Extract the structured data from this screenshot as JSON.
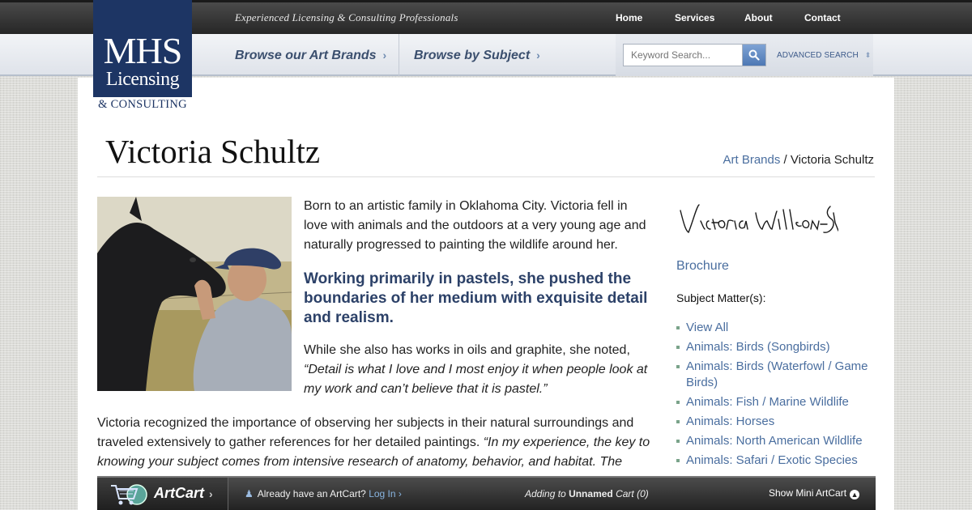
{
  "header": {
    "tagline": "Experienced Licensing & Consulting Professionals",
    "nav": [
      {
        "label": "Home"
      },
      {
        "label": "Services"
      },
      {
        "label": "About"
      },
      {
        "label": "Contact"
      }
    ]
  },
  "logo": {
    "line1": "MHS",
    "line2": "Licensing",
    "line3": "& CONSULTING"
  },
  "subnav": {
    "items": [
      {
        "label": "Browse our Art Brands",
        "icon": "chevron-right-icon"
      },
      {
        "label": "Browse by Subject",
        "icon": "chevron-right-icon"
      }
    ],
    "search_placeholder": "Keyword Search...",
    "search_icon": "search-icon",
    "advanced_search": "ADVANCED SEARCH"
  },
  "page": {
    "title": "Victoria Schultz",
    "breadcrumb_link": "Art Brands",
    "breadcrumb_sep": " / ",
    "breadcrumb_current": "Victoria Schultz"
  },
  "content": {
    "para1": "Born to an artistic family in Oklahoma City. Victoria fell in love with animals and the outdoors at a very young age and naturally progressed to painting the wildlife around her.",
    "pull_quote": "Working primarily in pastels, she pushed the boundaries of her medium with exquisite detail and realism.",
    "para2_a": "While she also has works in oils and graphite, she noted, ",
    "para2_quote": "“Detail is what I love and I most enjoy it when people look at my work and can’t believe that it is pastel.”",
    "para3_a": "Victoria recognized the importance of observing her subjects in their natural surroundings and traveled extensively to gather references for her detailed paintings. ",
    "para3_quote": "“In my experience, the key to knowing your subject comes from intensive research of anatomy, behavior, and habitat. The"
  },
  "sidebar": {
    "signature": "Victoria Wilson-Schultz",
    "brochure": "Brochure",
    "subject_heading": "Subject Matter(s):",
    "subjects": [
      "View All",
      "Animals: Birds (Songbirds)",
      "Animals: Birds (Waterfowl / Game Birds)",
      "Animals: Fish / Marine Wildlife",
      "Animals: Horses",
      "Animals: North American Wildlife",
      "Animals: Safari / Exotic Species"
    ]
  },
  "artcart": {
    "title": "ArtCart",
    "login_prompt": "Already have an ArtCart?",
    "login_link": "Log In",
    "adding_prefix": "Adding to",
    "cart_name": "Unnamed",
    "cart_suffix": "Cart (0)",
    "show_mini": "Show Mini ArtCart"
  },
  "colors": {
    "brand_navy": "#1d3564",
    "link_blue": "#4a6e9f",
    "pull_quote": "#2c4168"
  }
}
